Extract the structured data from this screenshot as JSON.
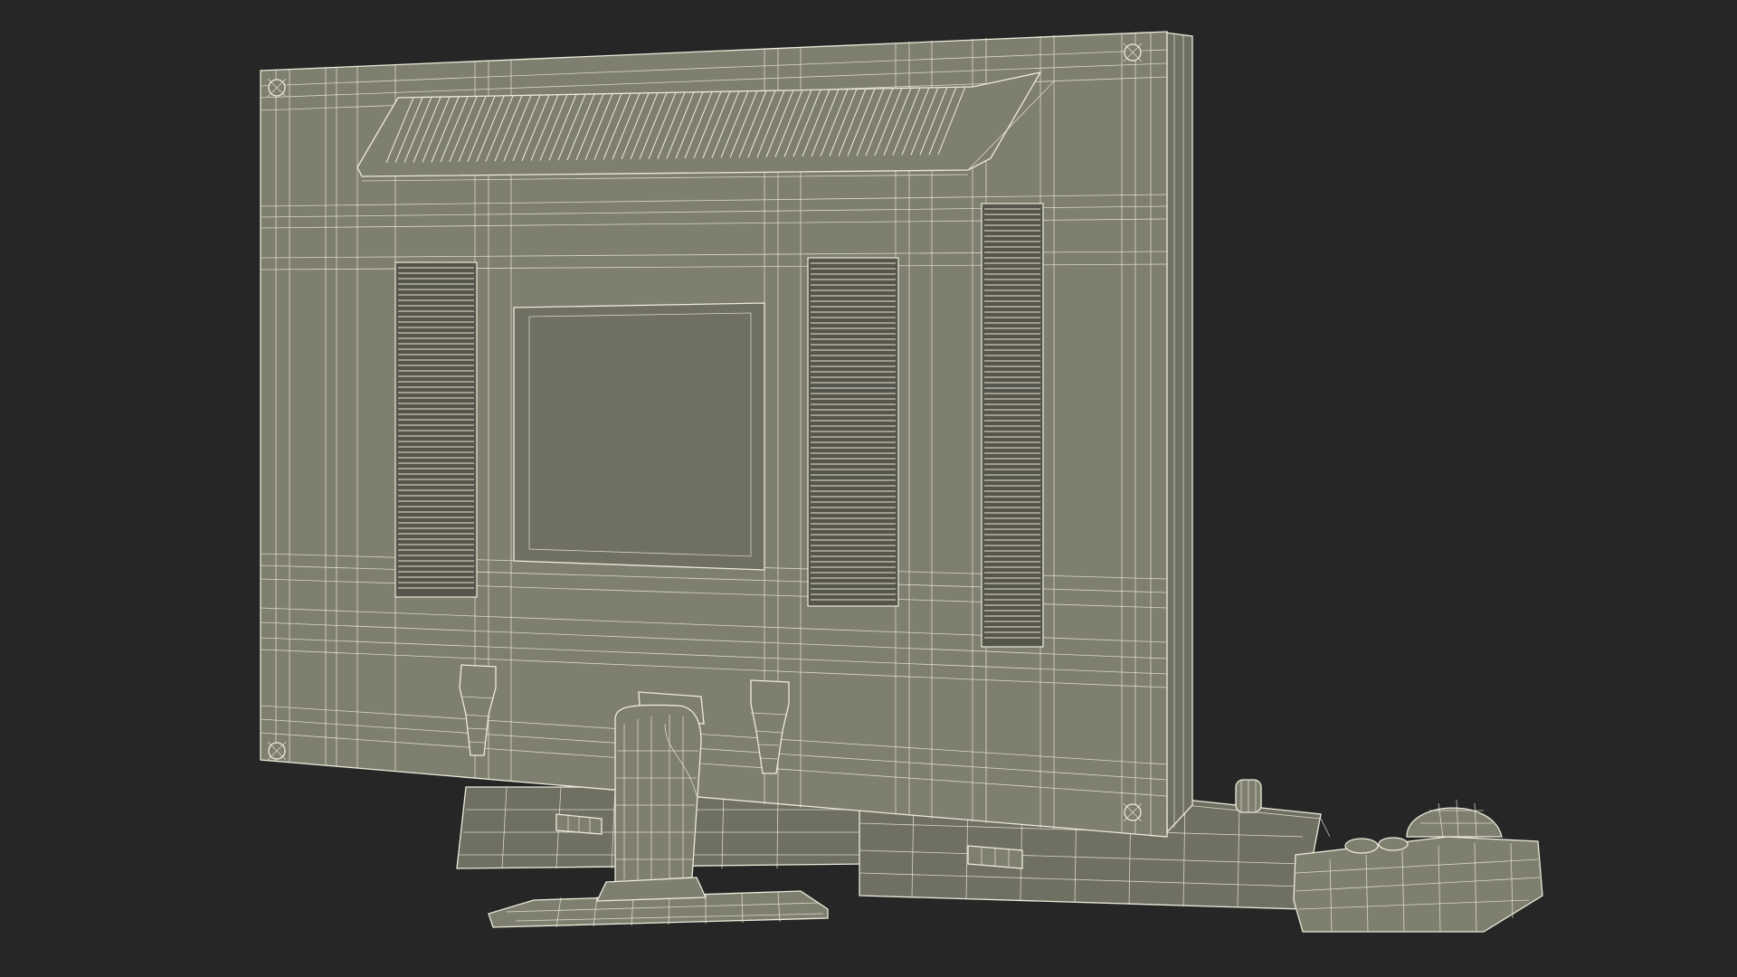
{
  "scene": {
    "background_color": "#262626",
    "model_fill_color": "#7f7f70",
    "wire_color": "#ecebdc",
    "vent_color": "#55554b"
  }
}
